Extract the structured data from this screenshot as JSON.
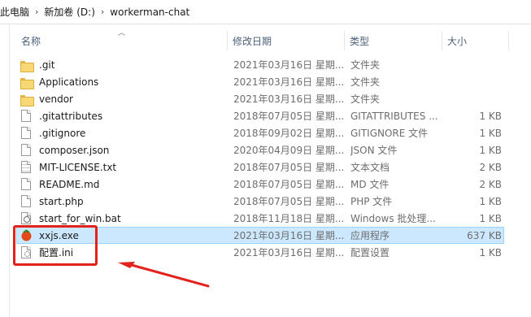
{
  "breadcrumb": [
    "此电脑",
    "新加卷 (D:)",
    "workerman-chat"
  ],
  "headers": {
    "name": "名称",
    "date": "修改日期",
    "type": "类型",
    "size": "大小"
  },
  "rows": [
    {
      "name": ".git",
      "date": "2021年03月16日 星期...",
      "type": "文件夹",
      "size": "",
      "icon": "folder-icon"
    },
    {
      "name": "Applications",
      "date": "2021年03月16日 星期...",
      "type": "文件夹",
      "size": "",
      "icon": "folder-icon"
    },
    {
      "name": "vendor",
      "date": "2021年03月16日 星期...",
      "type": "文件夹",
      "size": "",
      "icon": "folder-icon"
    },
    {
      "name": ".gitattributes",
      "date": "2018年07月05日 星期...",
      "type": "GITATTRIBUTES ...",
      "size": "1 KB",
      "icon": "file-icon"
    },
    {
      "name": ".gitignore",
      "date": "2018年09月02日 星期...",
      "type": "GITIGNORE 文件",
      "size": "1 KB",
      "icon": "file-icon"
    },
    {
      "name": "composer.json",
      "date": "2020年04月09日 星期...",
      "type": "JSON 文件",
      "size": "1 KB",
      "icon": "file-icon"
    },
    {
      "name": "MIT-LICENSE.txt",
      "date": "2018年07月05日 星期...",
      "type": "文本文档",
      "size": "2 KB",
      "icon": "text-file-icon"
    },
    {
      "name": "README.md",
      "date": "2018年07月05日 星期...",
      "type": "MD 文件",
      "size": "2 KB",
      "icon": "file-icon"
    },
    {
      "name": "start.php",
      "date": "2018年07月05日 星期...",
      "type": "PHP 文件",
      "size": "1 KB",
      "icon": "file-icon"
    },
    {
      "name": "start_for_win.bat",
      "date": "2018年11月18日 星期...",
      "type": "Windows 批处理...",
      "size": "1 KB",
      "icon": "batch-file-icon"
    },
    {
      "name": "xxjs.exe",
      "date": "2021年03月16日 星期...",
      "type": "应用程序",
      "size": "637 KB",
      "icon": "tomato-app-icon",
      "selected": true
    },
    {
      "name": "配置.ini",
      "date": "2021年03月16日 星期...",
      "type": "配置设置",
      "size": "1 KB",
      "icon": "ini-settings-icon"
    }
  ],
  "colors": {
    "selection": "#cce8ff",
    "annotation": "#e3231b",
    "folder": "#f8d775"
  }
}
